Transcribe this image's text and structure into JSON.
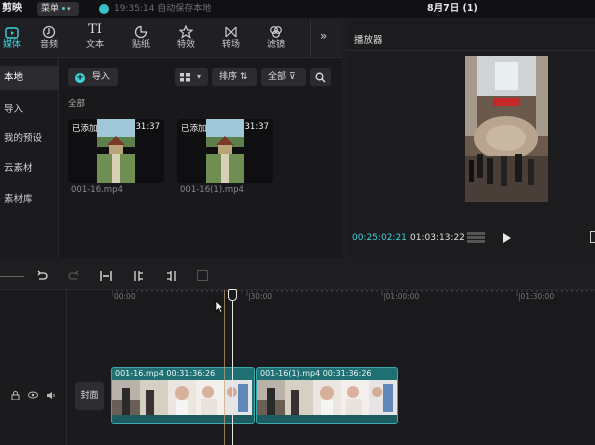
{
  "app": {
    "title": "剪映",
    "menu_label": "菜单",
    "autosave_time": "19:35:14",
    "autosave_text": "自动保存本地",
    "project_title": "8月7日 (1)"
  },
  "toolbar": {
    "items": [
      {
        "label": "媒体",
        "icon": "media-icon"
      },
      {
        "label": "音频",
        "icon": "audio-icon"
      },
      {
        "label": "文本",
        "icon": "text-icon",
        "glyph": "TI"
      },
      {
        "label": "贴纸",
        "icon": "sticker-icon"
      },
      {
        "label": "特效",
        "icon": "effects-icon"
      },
      {
        "label": "转场",
        "icon": "transition-icon"
      },
      {
        "label": "滤镜",
        "icon": "filter-icon"
      }
    ],
    "more": "»"
  },
  "sidebar": {
    "items": [
      "本地",
      "导入",
      "我的预设",
      "云素材",
      "素材库"
    ]
  },
  "media": {
    "import_label": "导入",
    "sort_label": "排序",
    "filter_label": "全部",
    "section_label": "全部",
    "items": [
      {
        "badge": "已添加",
        "duration": "31:37",
        "name": "001-16.mp4"
      },
      {
        "badge": "已添加",
        "duration": "31:37",
        "name": "001-16(1).mp4"
      }
    ]
  },
  "player": {
    "title": "播放器",
    "current_time": "00:25:02:21",
    "total_time": "01:03:13:22"
  },
  "timeline": {
    "ruler": [
      "00:00",
      "|30:00",
      "|01:00:00",
      "|01:30:00"
    ],
    "cover_label": "封面",
    "clips": [
      {
        "name": "001-16.mp4",
        "duration": "00:31:36:26"
      },
      {
        "name": "001-16(1).mp4",
        "duration": "00:31:36:26"
      }
    ]
  },
  "colors": {
    "accent": "#3ed2db",
    "clip": "#1f6f73",
    "playhead": "#e8e8e8"
  }
}
